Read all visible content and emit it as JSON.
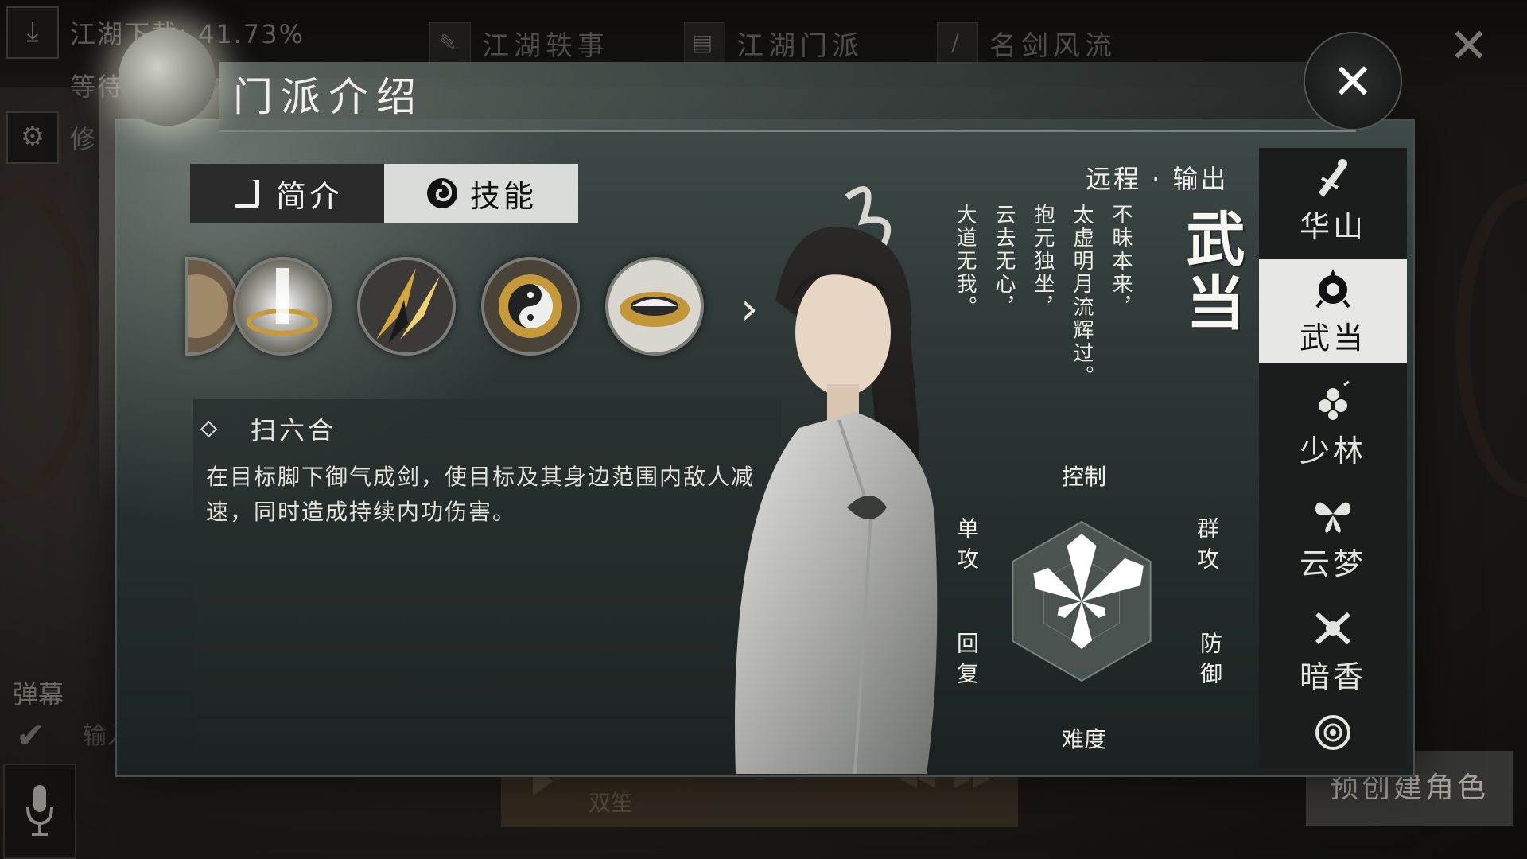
{
  "hud": {
    "download_status": "江湖下载: 41.73%",
    "line2": "等待",
    "line3": "修",
    "tabs": [
      "江湖轶事",
      "江湖门派",
      "名剑风流"
    ],
    "danmu_label": "弹幕",
    "input_placeholder": "输入",
    "music_song": "双笙",
    "precreate_button": "预创建角色"
  },
  "panel": {
    "title": "门派介绍",
    "tabs": {
      "intro": "简介",
      "skill": "技能"
    },
    "skill_icons": [
      "partial-skill-icon",
      "light-pillar-skill-icon",
      "blade-slash-skill-icon",
      "yinyang-fire-skill-icon",
      "yinyang-sword-skill-icon"
    ],
    "skill": {
      "name": "扫六合",
      "description": "在目标脚下御气成剑，使目标及其身边范围内敌人减速，同时造成持续内功伤害。"
    },
    "role": "远程 · 输出",
    "sect_name": "武当",
    "poem": [
      "不昧本来，",
      "太虚明月流辉过。",
      "抱元独坐，",
      "云去无心，",
      "大道无我。"
    ],
    "radar": {
      "labels": {
        "top": "控制",
        "top_right": "群攻",
        "bottom_right": "防御",
        "bottom": "难度",
        "bottom_left": "回复",
        "top_left": "单攻"
      },
      "values": {
        "top": 0.85,
        "top_right": 0.9,
        "bottom_right": 0.35,
        "bottom": 0.6,
        "bottom_left": 0.35,
        "top_left": 0.7
      }
    }
  },
  "sidebar": {
    "items": [
      {
        "name": "华山",
        "icon": "huashan-emblem-icon",
        "active": false
      },
      {
        "name": "武当",
        "icon": "wudang-emblem-icon",
        "active": true
      },
      {
        "name": "少林",
        "icon": "shaolin-emblem-icon",
        "active": false
      },
      {
        "name": "云梦",
        "icon": "yunmeng-butterfly-icon",
        "active": false
      },
      {
        "name": "暗香",
        "icon": "anxiang-emblem-icon",
        "active": false
      },
      {
        "name": "",
        "icon": "wheel-emblem-icon",
        "active": false
      }
    ]
  },
  "colors": {
    "active_tab_bg": "#d9dcd8",
    "panel_bg": "#2c3534",
    "text": "#e8e6e0"
  }
}
